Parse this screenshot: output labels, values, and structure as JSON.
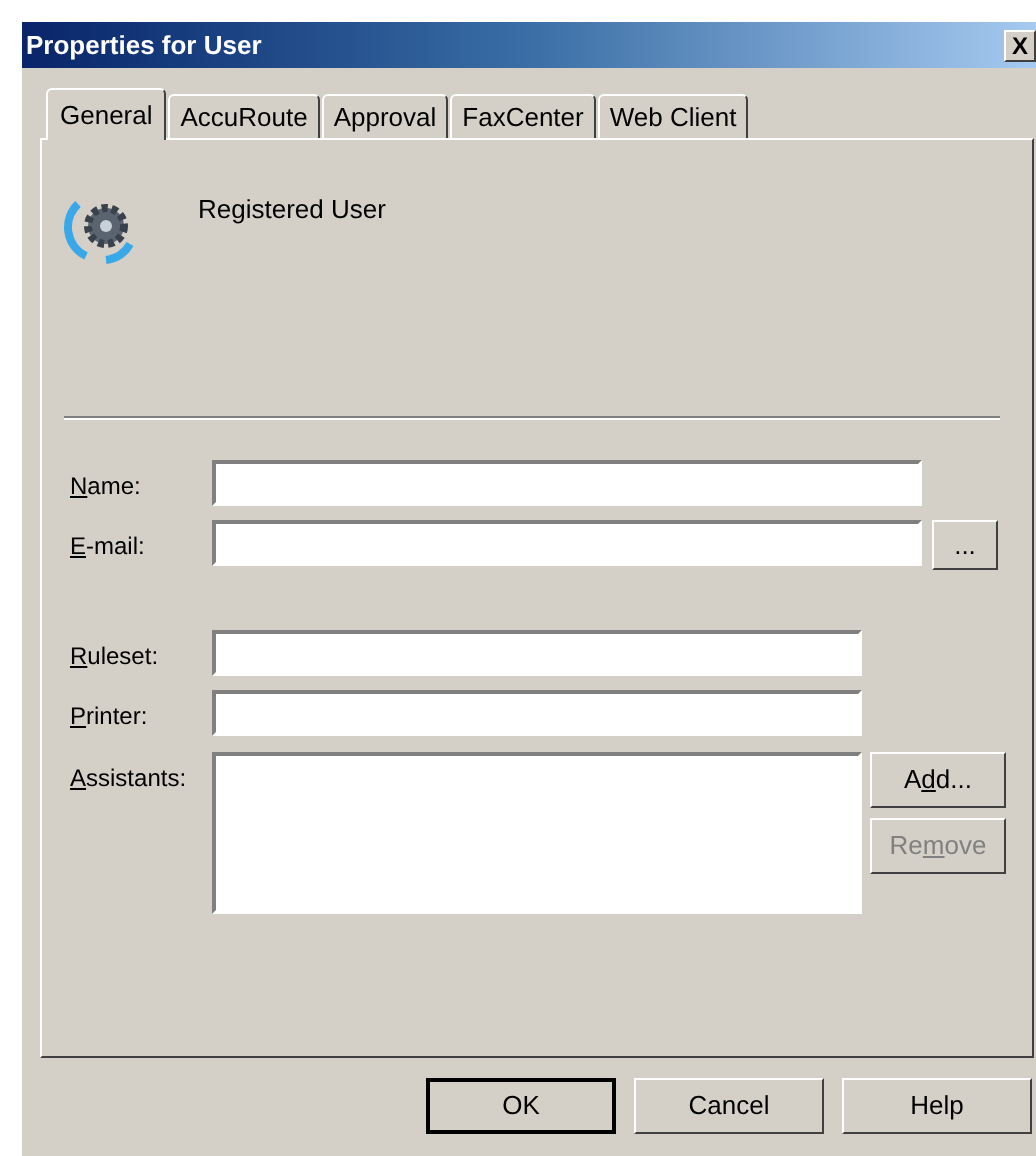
{
  "window": {
    "title": "Properties for User",
    "close": "X"
  },
  "tabs": [
    {
      "label": "General",
      "selected": true
    },
    {
      "label": "AccuRoute",
      "selected": false
    },
    {
      "label": "Approval",
      "selected": false
    },
    {
      "label": "FaxCenter",
      "selected": false
    },
    {
      "label": "Web Client",
      "selected": false
    }
  ],
  "header": {
    "text": "Registered User"
  },
  "fields": [
    {
      "kind": "text",
      "label": [
        {
          "text": "N",
          "underline": true
        },
        {
          "text": "ame:",
          "underline": false
        }
      ]
    },
    {
      "kind": "text",
      "label": [
        {
          "text": "E",
          "underline": true
        },
        {
          "text": "-mail:",
          "underline": false
        }
      ],
      "button": {
        "label": [
          {
            "text": "...",
            "underline": false
          }
        ],
        "disabled": false
      }
    },
    {
      "kind": "text",
      "label": [
        {
          "text": "R",
          "underline": true
        },
        {
          "text": "uleset:",
          "underline": false
        }
      ]
    },
    {
      "kind": "text",
      "label": [
        {
          "text": "P",
          "underline": true
        },
        {
          "text": "rinter:",
          "underline": false
        }
      ]
    },
    {
      "kind": "list",
      "label": [
        {
          "text": "A",
          "underline": true
        },
        {
          "text": "ssistants:",
          "underline": false
        }
      ],
      "buttons": [
        {
          "label": [
            {
              "text": "A",
              "underline": false
            },
            {
              "text": "d",
              "underline": true
            },
            {
              "text": "d...",
              "underline": false
            }
          ],
          "disabled": false
        },
        {
          "label": [
            {
              "text": "Re",
              "underline": false
            },
            {
              "text": "m",
              "underline": true
            },
            {
              "text": "ove",
              "underline": false
            }
          ],
          "disabled": true
        }
      ]
    }
  ],
  "buttons": [
    {
      "label": "OK",
      "default": true
    },
    {
      "label": "Cancel",
      "default": false
    },
    {
      "label": "Help",
      "default": false
    }
  ]
}
